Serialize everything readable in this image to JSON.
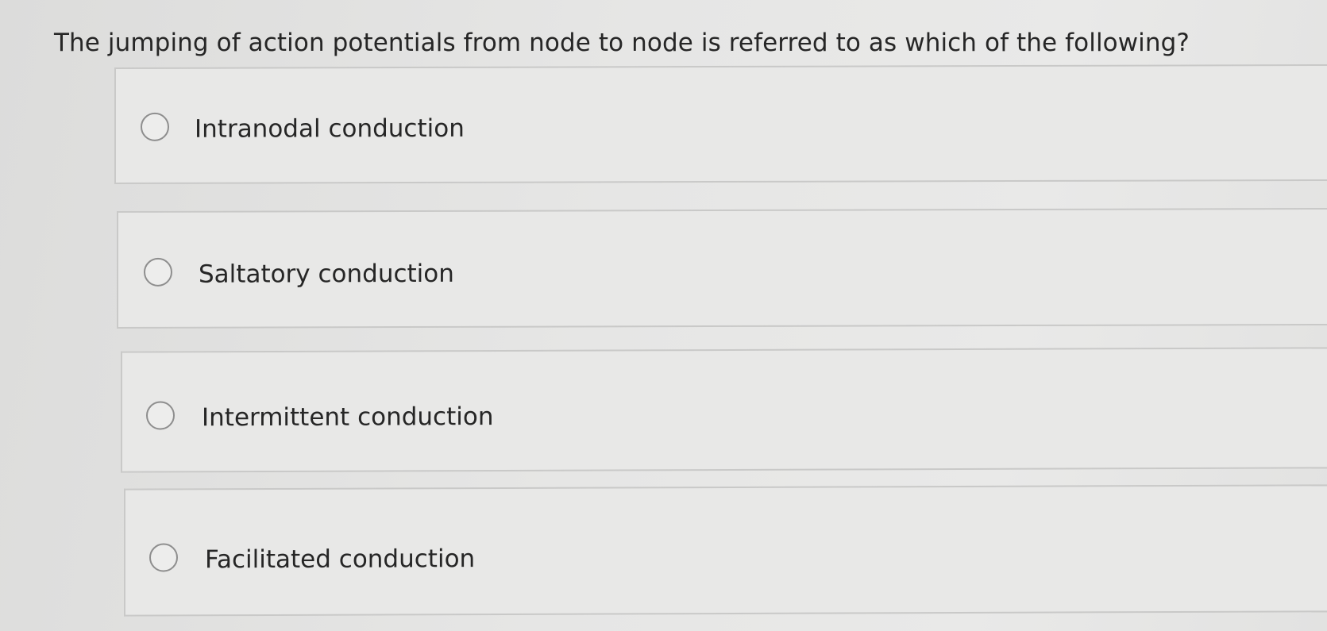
{
  "question": {
    "text": "The jumping of action potentials from node to node is referred to as which of the following?"
  },
  "options": [
    {
      "label": "Intranodal conduction"
    },
    {
      "label": "Saltatory conduction"
    },
    {
      "label": "Intermittent conduction"
    },
    {
      "label": "Facilitated conduction"
    }
  ],
  "icons": {
    "radio": "radio-button-unselected-icon"
  }
}
